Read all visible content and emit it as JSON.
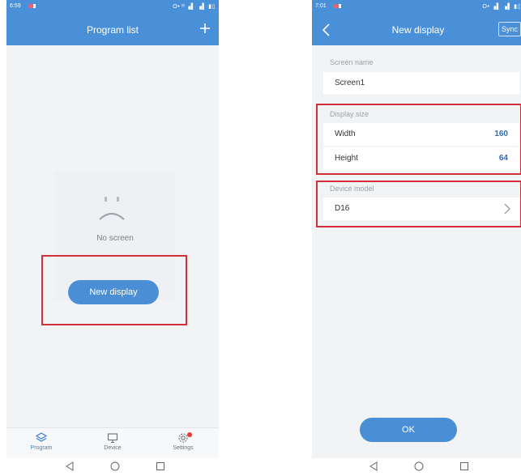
{
  "left_screen": {
    "status": {
      "time": "6:59",
      "icons": "O• ᴴ ▗▌ ▗▌ ▮▯"
    },
    "header": {
      "title": "Program list",
      "add_icon": "plus-icon"
    },
    "empty_state": {
      "icon": "sad-face-icon",
      "message": "No screen"
    },
    "new_display_button": "New display",
    "tabs": [
      {
        "label": "Program",
        "icon": "layers-icon",
        "active": true
      },
      {
        "label": "Device",
        "icon": "monitor-icon",
        "active": false
      },
      {
        "label": "Settings",
        "icon": "gear-icon",
        "active": false,
        "badge": true
      }
    ]
  },
  "right_screen": {
    "status": {
      "time": "7:01",
      "icons": "O• ▗▌ ▗▌ ▮▯"
    },
    "header": {
      "title": "New display",
      "back_icon": "back-arrow-icon",
      "sync_label": "Sync"
    },
    "screen_name": {
      "label": "Screen name",
      "value": "Screen1"
    },
    "display_size": {
      "label": "Display size",
      "width_label": "Width",
      "width_value": "160",
      "height_label": "Height",
      "height_value": "64"
    },
    "device_model": {
      "label": "Device model",
      "value": "D16",
      "icon": "chevron-right-icon"
    },
    "ok_button": "OK"
  },
  "nav_bar": {
    "icons": [
      "back-triangle-icon",
      "home-circle-icon",
      "recents-square-icon"
    ]
  },
  "colors": {
    "primary": "#4a90d8",
    "highlight": "#d32f3a",
    "value_text": "#2f6bb5",
    "badge": "#e53935"
  }
}
